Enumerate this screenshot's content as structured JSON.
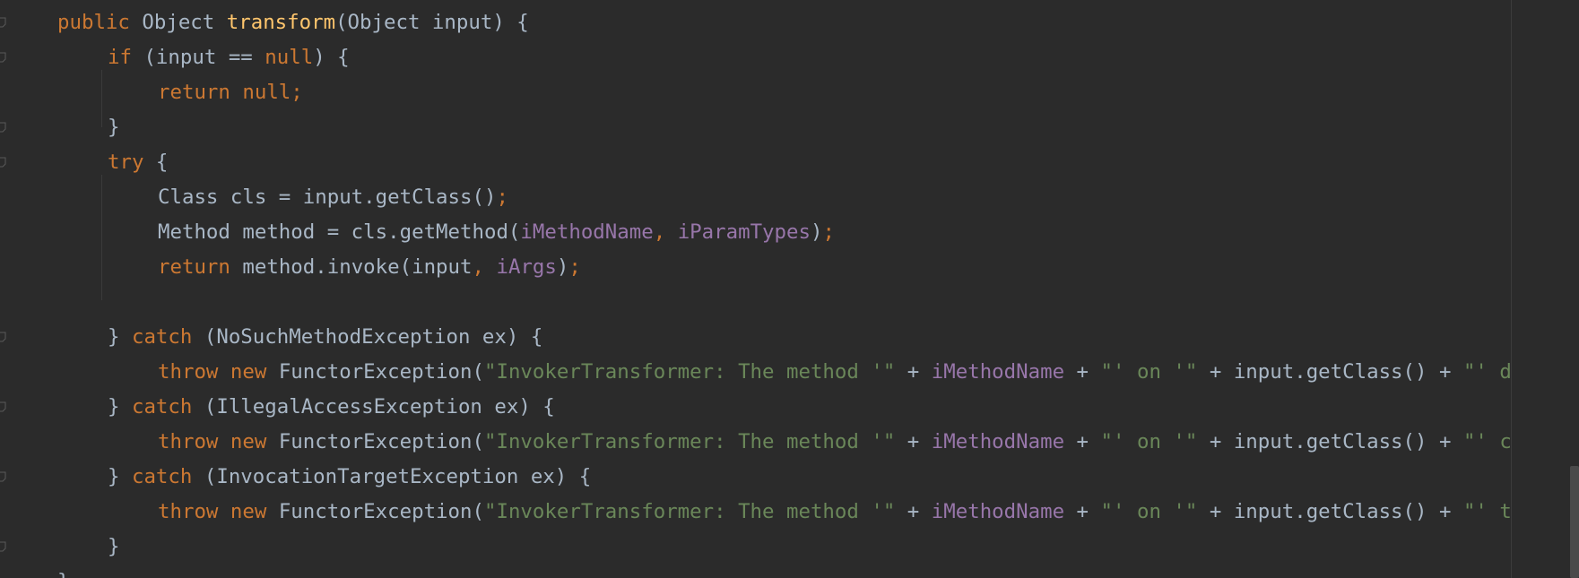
{
  "editor": {
    "lines": [
      {
        "indent": 0,
        "tokens": [
          {
            "t": "kw",
            "v": "public "
          },
          {
            "t": "plain",
            "v": "Object "
          },
          {
            "t": "fn",
            "v": "transform"
          },
          {
            "t": "plain",
            "v": "(Object input) {"
          }
        ]
      },
      {
        "indent": 1,
        "tokens": [
          {
            "t": "kw",
            "v": "if "
          },
          {
            "t": "plain",
            "v": "(input == "
          },
          {
            "t": "kw",
            "v": "null"
          },
          {
            "t": "plain",
            "v": ") {"
          }
        ]
      },
      {
        "indent": 2,
        "tokens": [
          {
            "t": "kw",
            "v": "return null;"
          }
        ]
      },
      {
        "indent": 1,
        "tokens": [
          {
            "t": "plain",
            "v": "}"
          }
        ]
      },
      {
        "indent": 1,
        "tokens": [
          {
            "t": "kw",
            "v": "try "
          },
          {
            "t": "plain",
            "v": "{"
          }
        ]
      },
      {
        "indent": 2,
        "tokens": [
          {
            "t": "plain",
            "v": "Class cls = input.getClass()"
          },
          {
            "t": "kw",
            "v": ";"
          }
        ]
      },
      {
        "indent": 2,
        "tokens": [
          {
            "t": "plain",
            "v": "Method method = cls.getMethod("
          },
          {
            "t": "fld",
            "v": "iMethodName"
          },
          {
            "t": "kw",
            "v": ", "
          },
          {
            "t": "fld",
            "v": "iParamTypes"
          },
          {
            "t": "plain",
            "v": ")"
          },
          {
            "t": "kw",
            "v": ";"
          }
        ]
      },
      {
        "indent": 2,
        "tokens": [
          {
            "t": "kw",
            "v": "return "
          },
          {
            "t": "plain",
            "v": "method.invoke(input"
          },
          {
            "t": "kw",
            "v": ", "
          },
          {
            "t": "fld",
            "v": "iArgs"
          },
          {
            "t": "plain",
            "v": ")"
          },
          {
            "t": "kw",
            "v": ";"
          }
        ]
      },
      {
        "indent": 2,
        "tokens": []
      },
      {
        "indent": 1,
        "tokens": [
          {
            "t": "plain",
            "v": "} "
          },
          {
            "t": "kw",
            "v": "catch "
          },
          {
            "t": "plain",
            "v": "(NoSuchMethodException ex) {"
          }
        ]
      },
      {
        "indent": 2,
        "tokens": [
          {
            "t": "kw",
            "v": "throw new "
          },
          {
            "t": "plain",
            "v": "FunctorException("
          },
          {
            "t": "str",
            "v": "\"InvokerTransformer: The method '\""
          },
          {
            "t": "plain",
            "v": " + "
          },
          {
            "t": "fld",
            "v": "iMethodName"
          },
          {
            "t": "plain",
            "v": " + "
          },
          {
            "t": "str",
            "v": "\"' on '\""
          },
          {
            "t": "plain",
            "v": " + input.getClass() + "
          },
          {
            "t": "str",
            "v": "\"' do"
          }
        ]
      },
      {
        "indent": 1,
        "tokens": [
          {
            "t": "plain",
            "v": "} "
          },
          {
            "t": "kw",
            "v": "catch "
          },
          {
            "t": "plain",
            "v": "(IllegalAccessException ex) {"
          }
        ]
      },
      {
        "indent": 2,
        "tokens": [
          {
            "t": "kw",
            "v": "throw new "
          },
          {
            "t": "plain",
            "v": "FunctorException("
          },
          {
            "t": "str",
            "v": "\"InvokerTransformer: The method '\""
          },
          {
            "t": "plain",
            "v": " + "
          },
          {
            "t": "fld",
            "v": "iMethodName"
          },
          {
            "t": "plain",
            "v": " + "
          },
          {
            "t": "str",
            "v": "\"' on '\""
          },
          {
            "t": "plain",
            "v": " + input.getClass() + "
          },
          {
            "t": "str",
            "v": "\"' ca"
          }
        ]
      },
      {
        "indent": 1,
        "tokens": [
          {
            "t": "plain",
            "v": "} "
          },
          {
            "t": "kw",
            "v": "catch "
          },
          {
            "t": "plain",
            "v": "(InvocationTargetException ex) {"
          }
        ]
      },
      {
        "indent": 2,
        "tokens": [
          {
            "t": "kw",
            "v": "throw new "
          },
          {
            "t": "plain",
            "v": "FunctorException("
          },
          {
            "t": "str",
            "v": "\"InvokerTransformer: The method '\""
          },
          {
            "t": "plain",
            "v": " + "
          },
          {
            "t": "fld",
            "v": "iMethodName"
          },
          {
            "t": "plain",
            "v": " + "
          },
          {
            "t": "str",
            "v": "\"' on '\""
          },
          {
            "t": "plain",
            "v": " + input.getClass() + "
          },
          {
            "t": "str",
            "v": "\"' th"
          }
        ]
      },
      {
        "indent": 1,
        "tokens": [
          {
            "t": "plain",
            "v": "}"
          }
        ]
      },
      {
        "indent": 0,
        "tokens": [
          {
            "t": "plain",
            "v": "}"
          }
        ]
      }
    ],
    "fold_marker_lines": [
      0,
      1,
      3,
      4,
      9,
      11,
      13,
      15
    ]
  },
  "colors": {
    "background": "#2b2b2b",
    "keyword": "#cc7832",
    "function": "#ffc66d",
    "field": "#9876aa",
    "string": "#6a8759",
    "plain": "#a9b7c6"
  }
}
